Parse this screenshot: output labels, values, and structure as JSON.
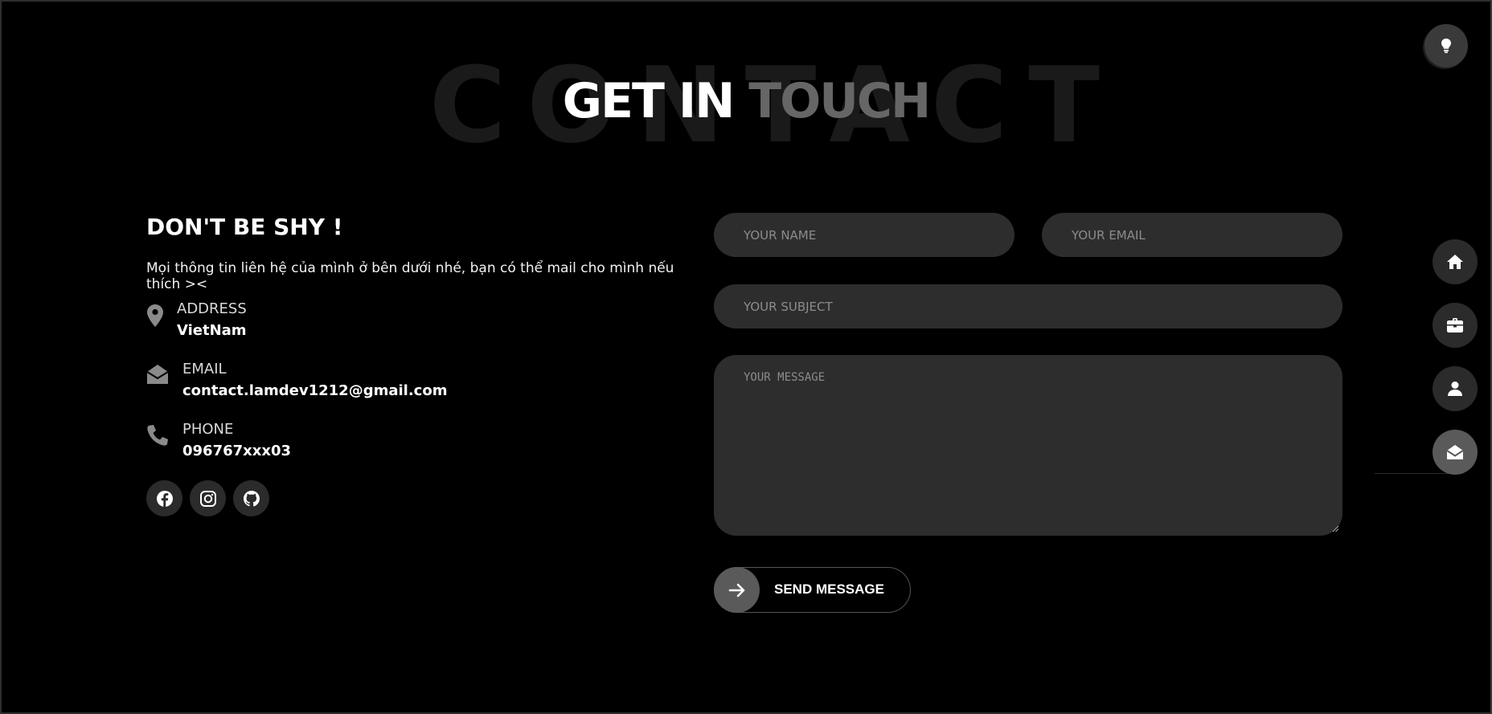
{
  "header": {
    "background_word": "CONTACT",
    "title_part1": "GET IN",
    "title_part2": "TOUCH"
  },
  "contact": {
    "heading": "DON'T BE SHY !",
    "intro": "Mọi thông tin liên hệ của mình ở bên dưới nhé, bạn có thể mail cho mình nếu thích ><",
    "items": [
      {
        "label": "ADDRESS",
        "value": "VietNam",
        "icon": "location-pin-icon"
      },
      {
        "label": "EMAIL",
        "value": "contact.lamdev1212@gmail.com",
        "icon": "envelope-open-icon"
      },
      {
        "label": "PHONE",
        "value": "096767xxx03",
        "icon": "phone-icon"
      }
    ],
    "socials": [
      "facebook-icon",
      "instagram-icon",
      "github-icon"
    ]
  },
  "form": {
    "name_placeholder": "YOUR NAME",
    "email_placeholder": "YOUR EMAIL",
    "subject_placeholder": "YOUR SUBJECT",
    "message_placeholder": "YOUR MESSAGE",
    "send_label": "SEND MESSAGE"
  },
  "nav": {
    "items": [
      "home-icon",
      "briefcase-icon",
      "user-icon",
      "envelope-open-icon"
    ],
    "active": "envelope-open-icon",
    "theme_toggle": "lightbulb-icon"
  },
  "colors": {
    "background": "#000000",
    "field": "#2d2d2d",
    "accent_gray": "#666666",
    "active_nav": "#5a5a5a"
  }
}
